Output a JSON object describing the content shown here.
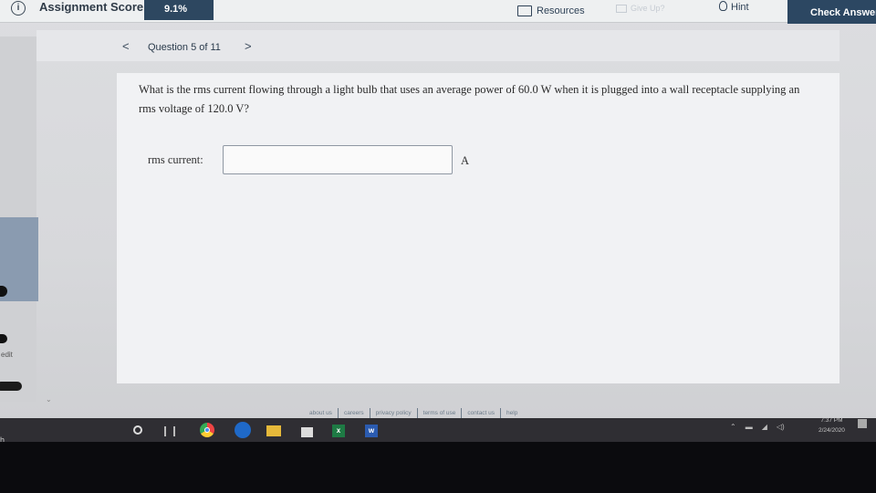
{
  "topbar": {
    "score_label": "Assignment Score:",
    "score_value": "9.1%",
    "resources_label": "Resources",
    "giveup_label": "Give Up?",
    "hint_label": "Hint",
    "check_label": "Check Answer"
  },
  "nav": {
    "prev": "<",
    "label": "Question 5 of 11",
    "next": ">"
  },
  "question": {
    "text": "What is the rms current flowing through a light bulb that uses an average power of 60.0 W when it is plugged into a wall receptacle supplying an rms voltage of 120.0 V?",
    "answer_label": "rms current:",
    "answer_value": "",
    "answer_unit": "A"
  },
  "sidebar": {
    "edit_label": "edit"
  },
  "footer": {
    "links": [
      "about us",
      "careers",
      "privacy policy",
      "terms of use",
      "contact us",
      "help"
    ]
  },
  "taskbar": {
    "start_letter": "h",
    "time": "7:37 PM",
    "date": "2/24/2020",
    "excel_letter": "x",
    "word_letter": "w"
  }
}
